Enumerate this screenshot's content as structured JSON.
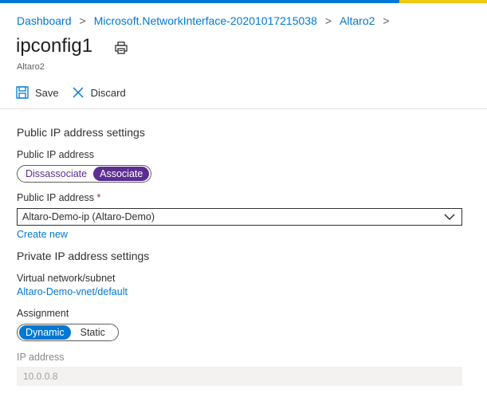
{
  "breadcrumb": {
    "items": [
      "Dashboard",
      "Microsoft.NetworkInterface-20201017215038",
      "Altaro2"
    ],
    "separator": ">"
  },
  "page": {
    "title": "ipconfig1",
    "subtitle": "Altaro2"
  },
  "toolbar": {
    "save_label": "Save",
    "discard_label": "Discard"
  },
  "public_ip": {
    "section_title": "Public IP address settings",
    "toggle_label": "Public IP address",
    "toggle_options": [
      "Dissassociate",
      "Associate"
    ],
    "toggle_selected": "Associate",
    "select_label": "Public IP address",
    "required_mark": "*",
    "select_value": "Altaro-Demo-ip (Altaro-Demo)",
    "create_new": "Create new"
  },
  "private_ip": {
    "section_title": "Private IP address settings",
    "subnet_label": "Virtual network/subnet",
    "subnet_value": "Altaro-Demo-vnet/default",
    "assignment_label": "Assignment",
    "assignment_options": [
      "Dynamic",
      "Static"
    ],
    "assignment_selected": "Dynamic",
    "ip_label": "IP address",
    "ip_value": "10.0.0.8"
  },
  "colors": {
    "accent": "#0078d4",
    "toggle_purple": "#5c2e91",
    "required": "#a4262c"
  }
}
